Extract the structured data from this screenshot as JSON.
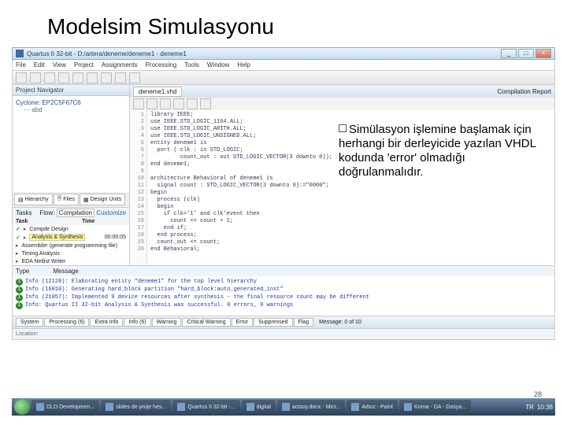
{
  "slide": {
    "title": "Modelsim Simulasyonu"
  },
  "window": {
    "title": "Quartus II 32-bit - D:/artera/deneme/deneme1 - deneme1"
  },
  "menu": [
    "File",
    "Edit",
    "View",
    "Project",
    "Assignments",
    "Processing",
    "Tools",
    "Window",
    "Help"
  ],
  "nav": {
    "title": "Project Navigator",
    "device": "Cyclone: EP2C5F67C6",
    "tabs": {
      "hierarchy": "Hierarchy",
      "files": "Files",
      "design": "Design Units"
    }
  },
  "tasks": {
    "title": "Tasks",
    "flow_label": "Flow:",
    "flow_value": "Compilation",
    "customize": "Customize",
    "time_label": "Time",
    "rows": [
      {
        "check": true,
        "text": "Compile Design"
      },
      {
        "check": true,
        "text": "Analysis & Synthesis",
        "time": "00:00:05",
        "hl": true
      },
      {
        "check": false,
        "text": "Assembler (generate programming file)"
      },
      {
        "check": false,
        "text": "Timing Analysis"
      },
      {
        "check": false,
        "text": "EDA Netlist Writer"
      }
    ]
  },
  "editor": {
    "file": "deneme1.vhd",
    "report_tab": "Compilation Report",
    "lines": [
      "library IEEE;",
      "use IEEE.STD_LOGIC_1164.ALL;",
      "use IEEE.STD_LOGIC_ARITH.ALL;",
      "use IEEE.STD_LOGIC_UNSIGNED.ALL;",
      "entity deneme1 is",
      "  port ( clk : in STD_LOGIC;",
      "         count_out : out STD_LOGIC_VECTOR(3 downto 0));",
      "end deneme1;",
      "",
      "architecture Behavioral of deneme1 is",
      "  signal count : STD_LOGIC_VECTOR(3 downto 0):=\"0000\";",
      "begin",
      "  process (clk)",
      "  begin",
      "    if clk='1' and clk'event then",
      "      count <= count + 1;",
      "    end if;",
      "  end process;",
      "  count_out <= count;",
      "end Behavioral;"
    ]
  },
  "overlay": {
    "text": "Simülasyon işlemine başlamak için herhangi bir derleyicide yazılan VHDL kodunda 'error' olmadığı doğrulanmalıdır."
  },
  "messages": {
    "head_type": "Type",
    "head_msg": "Message",
    "lines": [
      "Info (12128): Elaborating entity \"deneme1\" for the top level hierarchy",
      "Info (16010): Generating hard_block partition \"hard_block:auto_generated_inst\"",
      "Info (21057): Implemented 9 device resources after synthesis - the final resource count may be different",
      "Info: Quartus II 32-bit Analysis & Synthesis was successful. 0 errors, 0 warnings"
    ],
    "tabs": [
      "System",
      "Processing (6)",
      "Extra Info",
      "Info (6)",
      "Warning",
      "Critical Warning",
      "Error",
      "Suppressed",
      "Flag"
    ],
    "find": "Message: 0 of 10"
  },
  "status": {
    "location": "Location:"
  },
  "taskbar": {
    "items": [
      "DLD Developmen...",
      "slides de proje hes...",
      "Quartus II 32-bit -...",
      "digital",
      "actsoy.docx - Micr...",
      "Adsız - Paint",
      "Kırma - DA - Dosya..."
    ],
    "lang": "TR",
    "time": "10:38"
  },
  "page": "28"
}
